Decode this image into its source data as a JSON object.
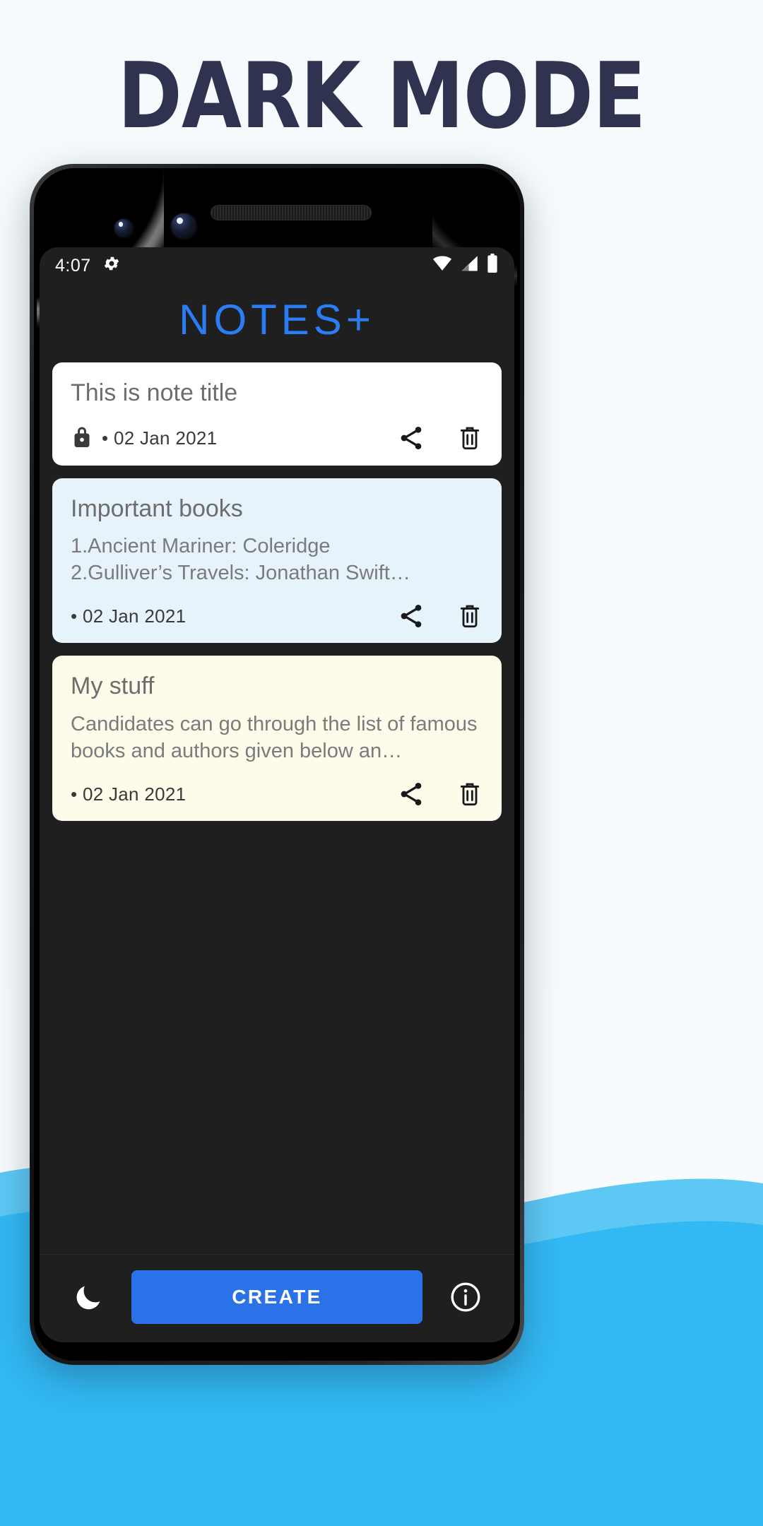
{
  "promo": {
    "headline": "DARK MODE",
    "background_color": "#f6fafc",
    "headline_color": "#2f3350",
    "wave_color": "#4fc3f7"
  },
  "phone": {
    "statusbar": {
      "time": "4:07",
      "left_icons": [
        "gear-icon"
      ],
      "right_icons": [
        "wifi-icon",
        "cellular-signal-icon",
        "battery-icon"
      ]
    }
  },
  "app": {
    "title": "NOTES+",
    "accent_color": "#2b7df5",
    "screen_background": "#1f1f1f",
    "notes": [
      {
        "title": "This is note title",
        "body": "",
        "date": "02 Jan 2021",
        "bullet": "•",
        "locked": true,
        "card_color": "#ffffff",
        "share_label": "share-icon",
        "delete_label": "delete-icon"
      },
      {
        "title": "Important books",
        "body": "1.Ancient Mariner: Coleridge\n2.Gulliver’s Travels: Jonathan Swift…",
        "date": "02 Jan 2021",
        "bullet": "•",
        "locked": false,
        "card_color": "#e7f3fb",
        "share_label": "share-icon",
        "delete_label": "delete-icon"
      },
      {
        "title": "My stuff",
        "body": "Candidates can go through the list of famous books and authors given below an…",
        "date": "02 Jan 2021",
        "bullet": "•",
        "locked": false,
        "card_color": "#fdfbea",
        "share_label": "share-icon",
        "delete_label": "delete-icon"
      }
    ],
    "bottom_bar": {
      "theme_toggle": "moon-icon",
      "create_label": "CREATE",
      "info": "info-icon"
    }
  }
}
